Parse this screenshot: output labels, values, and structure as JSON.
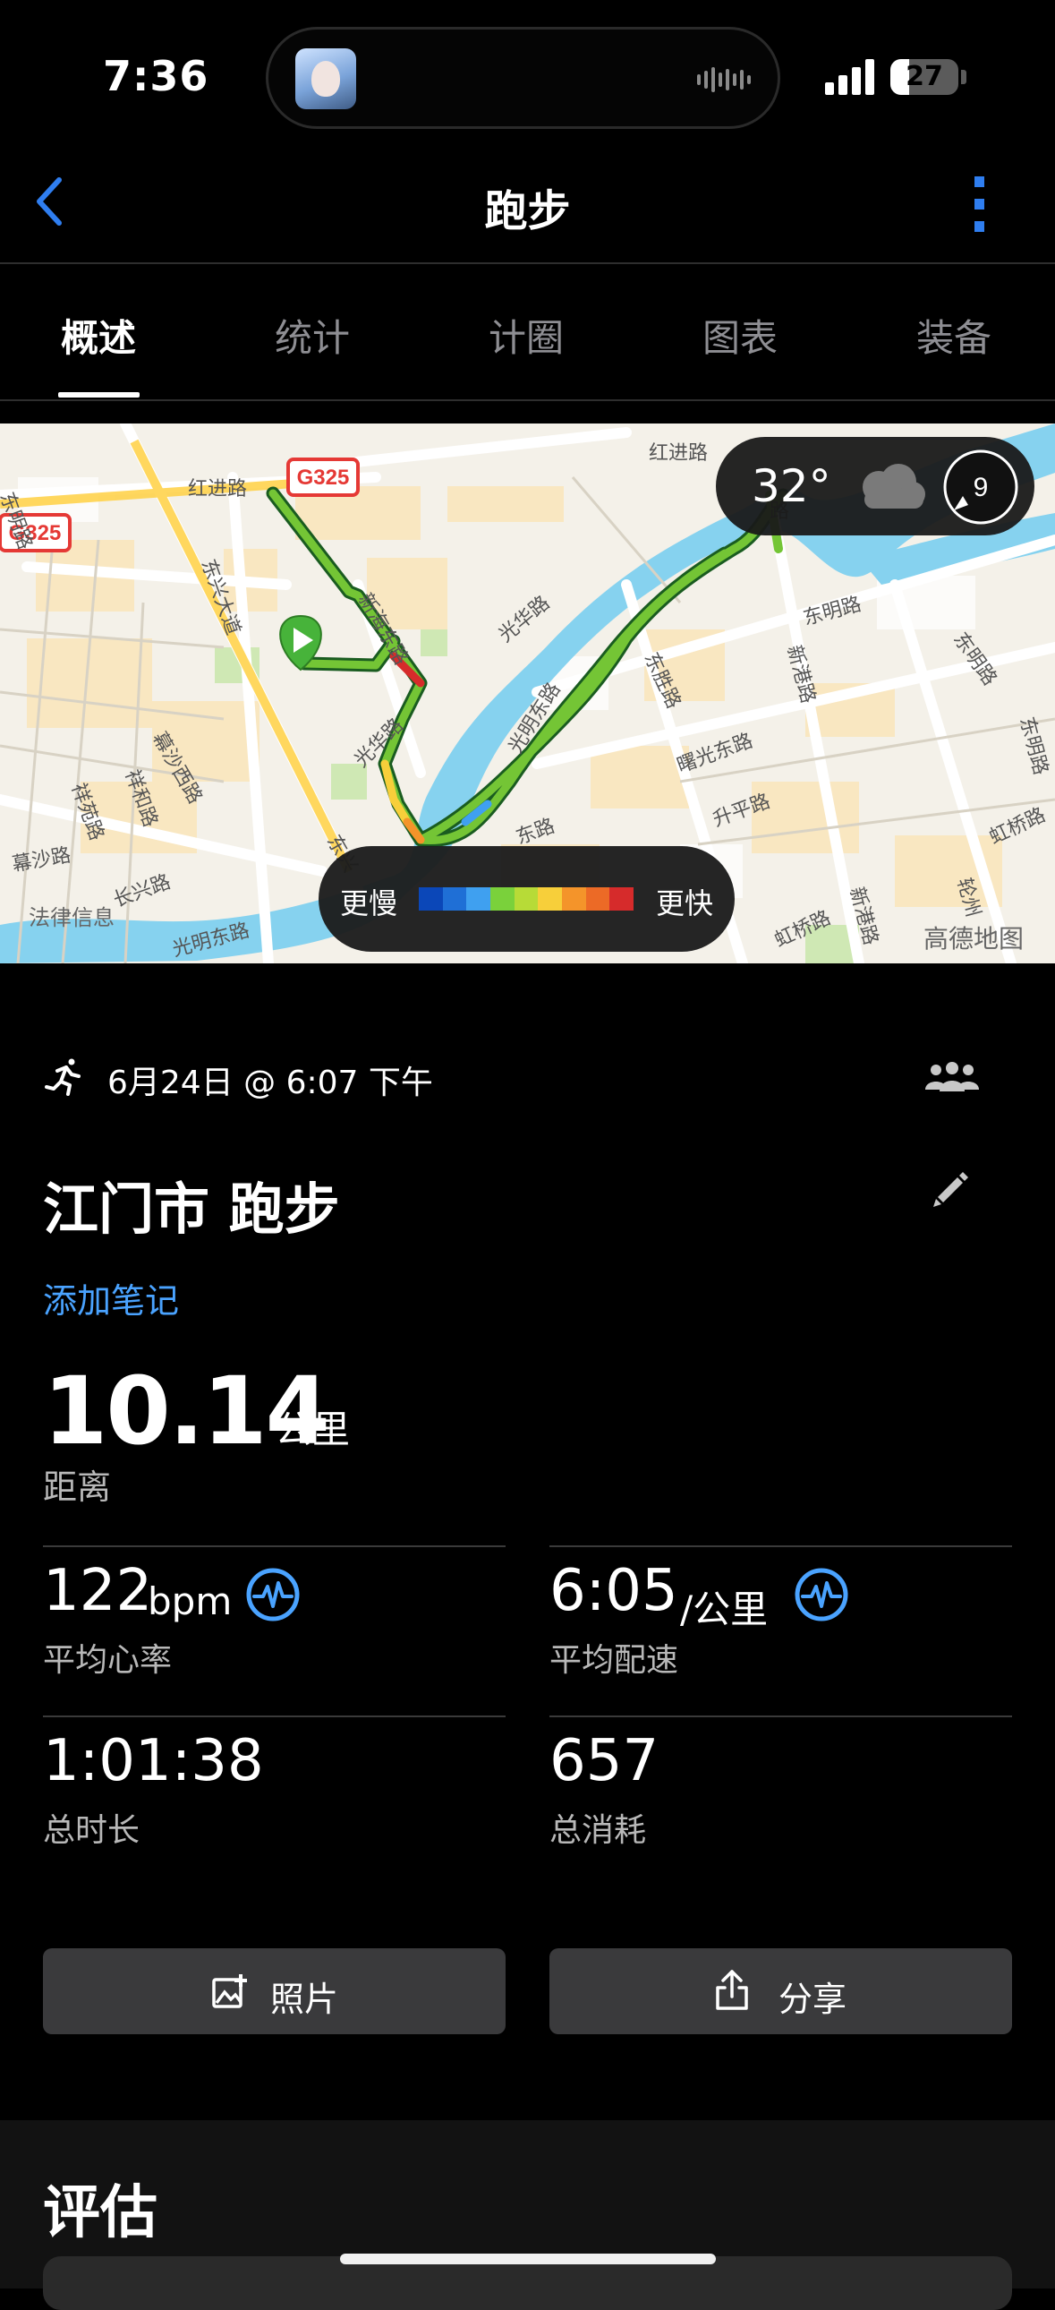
{
  "status_bar": {
    "time": "7:36",
    "battery": "27"
  },
  "nav": {
    "title": "跑步"
  },
  "tabs": [
    {
      "label": "概述"
    },
    {
      "label": "统计"
    },
    {
      "label": "计圈"
    },
    {
      "label": "图表"
    },
    {
      "label": "装备"
    }
  ],
  "map": {
    "weather": {
      "temp": "32°",
      "icon": "cloud-icon",
      "wind_speed": "9"
    },
    "legend": {
      "slow": "更慢",
      "fast": "更快",
      "colors": [
        "#0b47b8",
        "#1f6fd6",
        "#3fa0f0",
        "#7ad13b",
        "#b7db37",
        "#f7cf3a",
        "#f4942a",
        "#ec6a26",
        "#d62b2b"
      ]
    },
    "labels": {
      "road1": "红进路",
      "road2": "红进路",
      "road3": "东兴大道",
      "road4": "新海东路",
      "road5": "光华路",
      "road6": "光华路",
      "road7": "光明东路",
      "road8": "东胜路",
      "road9": "新港路",
      "road10": "东明路",
      "road11": "东明路",
      "road12": "曙光东路",
      "road13": "升平路",
      "road14": "幕沙西路",
      "road15": "祥和路",
      "road16": "祥苑路",
      "road17": "长兴路",
      "road18": "光明东路",
      "road19": "虹桥路",
      "road20": "虹桥路",
      "road21": "新港路",
      "road22": "东兴",
      "road23": "东明路",
      "road24": "幕沙路",
      "road25": "东路",
      "road26": "轮州",
      "road27": "路",
      "road28": "东明路",
      "highway1": "G325",
      "highway2": "G325",
      "watermark": "高德地图",
      "watermark2": "法律信息"
    }
  },
  "activity": {
    "date": "6月24日 @ 6:07 下午",
    "title": "江门市 跑步",
    "add_note": "添加笔记",
    "distance": {
      "value": "10.14",
      "unit": "公里",
      "label": "距离"
    },
    "stats": [
      {
        "value": "122",
        "unit": "bpm",
        "label": "平均心率"
      },
      {
        "value": "6:05",
        "unit": "/公里",
        "label": "平均配速"
      },
      {
        "value": "1:01:38",
        "unit": "",
        "label": "总时长"
      },
      {
        "value": "657",
        "unit": "",
        "label": "总消耗"
      }
    ]
  },
  "buttons": {
    "photos": "照片",
    "share": "分享"
  },
  "evaluation": {
    "title": "评估"
  },
  "colors": {
    "accent": "#4aa3ff",
    "back": "#2f7ef0",
    "route_green": "#74c535",
    "river": "#86d2ef"
  }
}
